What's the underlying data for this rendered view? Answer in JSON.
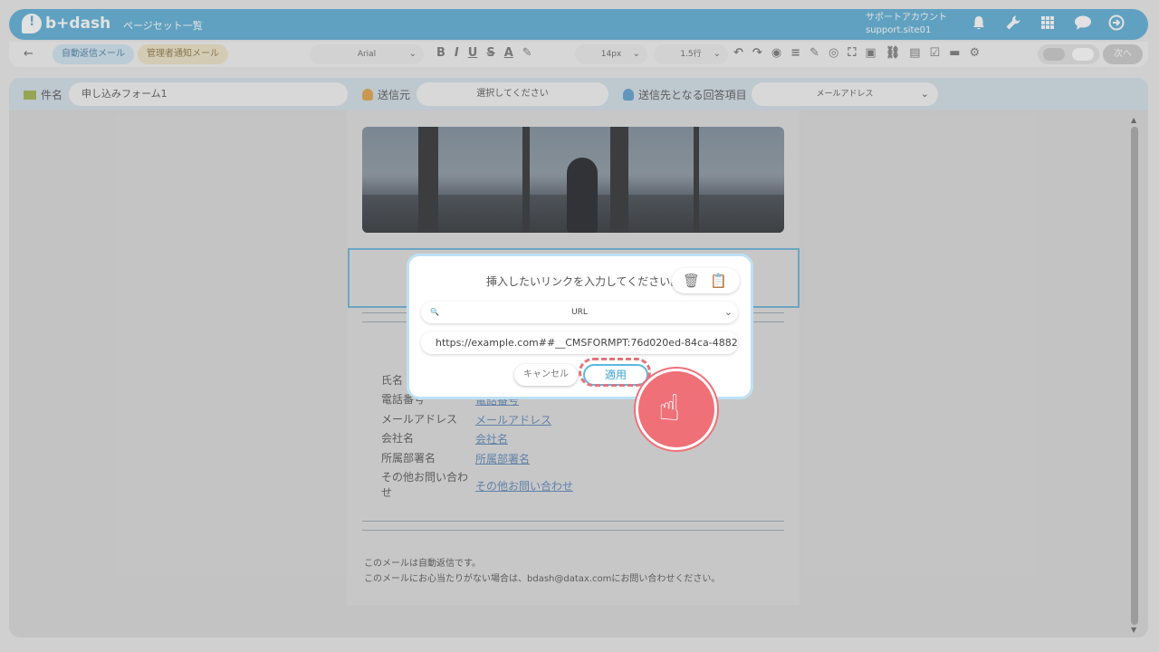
{
  "header": {
    "logo": "b+dash",
    "page_set_link": "ページセット一覧",
    "account_name": "サポートアカウント",
    "account_site": "support.site01",
    "icons": [
      "bell-icon",
      "wrench-icon",
      "grid-icon",
      "chat-icon",
      "logout-icon"
    ]
  },
  "toolbar": {
    "back": "←",
    "tabs": [
      {
        "label": "自動返信メール"
      },
      {
        "label": "管理者通知メール"
      }
    ],
    "font": "Arial",
    "size": "14px",
    "line_height": "1.5行",
    "next_label": "次へ"
  },
  "form": {
    "subject_label": "件名",
    "subject_value": "申し込みフォーム1",
    "from_label": "送信元",
    "from_value": "選択してください",
    "to_label": "送信先となる回答項目",
    "to_value": "メールアドレス"
  },
  "email": {
    "fields": [
      {
        "label": "氏名",
        "link": "氏名"
      },
      {
        "label": "電話番号",
        "link": "電話番号"
      },
      {
        "label": "メールアドレス",
        "link": "メールアドレス"
      },
      {
        "label": "会社名",
        "link": "会社名"
      },
      {
        "label": "所属部署名",
        "link": "所属部署名"
      },
      {
        "label": "その他お問い合わせ",
        "link": "その他お問い合わせ"
      }
    ],
    "footer_line1": "このメールは自動返信です。",
    "footer_line2": "このメールにお心当たりがない場合は、bdash@datax.comにお問い合わせください。"
  },
  "dialog": {
    "title": "挿入したいリンクを入力してください。",
    "link_type": "URL",
    "url_value": "https://example.com##__CMSFORMPT:76d020ed-84ca-4882-...",
    "cancel_label": "キャンセル",
    "apply_label": "適用"
  },
  "colors": {
    "header": "#5aaed6",
    "accent": "#3aa1d4",
    "highlight": "#e4747e"
  }
}
